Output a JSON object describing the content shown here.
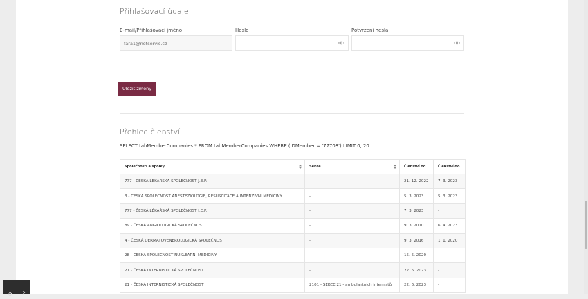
{
  "login": {
    "title": "Přihlašovací údaje",
    "email_label": "E-mail/Přihlašovací jméno",
    "email_value": "fara1@netservis.cz",
    "password_label": "Heslo",
    "confirm_label": "Potvrzení hesla",
    "save_label": "Uložit změny"
  },
  "membership": {
    "title": "Přehled členství",
    "sql": "SELECT tabMemberCompanies.* FROM tabMemberCompanies WHERE (IDMember = '77708') LIMIT 0, 20",
    "columns": [
      "Společnosti a spolky",
      "Sekce",
      "Členství od",
      "Členství do"
    ],
    "rows": [
      [
        "777 - ČESKÁ LÉKAŘSKÁ SPOLEČNOST J.E.P.",
        "-",
        "21. 12. 2022",
        "7. 3. 2023"
      ],
      [
        "3 - ČESKÁ SPOLEČNOST ANESTEZIOLOGIE, RESUSCITACE A INTENZIVNÍ MEDICÍNY",
        "-",
        "5. 3. 2023",
        "5. 3. 2023"
      ],
      [
        "777 - ČESKÁ LÉKAŘSKÁ SPOLEČNOST J.E.P.",
        "-",
        "7. 3. 2023",
        "-"
      ],
      [
        "89 - ČESKÁ ANGIOLOGICKÁ SPOLEČNOST",
        "-",
        "9. 3. 2010",
        "6. 4. 2023"
      ],
      [
        "4 - ČESKÁ DERMATOVENEROLOGICKÁ SPOLEČNOST",
        "-",
        "9. 3. 2016",
        "1. 1. 2020"
      ],
      [
        "28 - ČESKÁ SPOLEČNOST NUKLEÁRNÍ MEDICÍNY",
        "-",
        "15. 5. 2020",
        "-"
      ],
      [
        "21 - ČESKÁ INTERNISTICKÁ SPOLEČNOST",
        "-",
        "22. 6. 2023",
        "-"
      ],
      [
        "21 - ČESKÁ INTERNISTICKÁ SPOLEČNOST",
        "2101 - SEKCE 21 - ambulantních internistů",
        "22. 6. 2023",
        "-"
      ]
    ]
  },
  "icons": {
    "eye": "eye-icon",
    "sort": "sort-icon",
    "gear": "gear-icon",
    "chevron": "chevron-right-icon"
  },
  "colors": {
    "accent": "#7a2b44",
    "widget": "#2d2d2d"
  }
}
